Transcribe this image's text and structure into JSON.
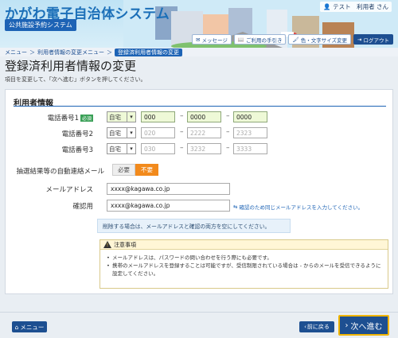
{
  "header": {
    "app_title": "かがわ電子自治体システム",
    "app_subtitle": "公共施設予約システム",
    "user_label": "テスト　利用者 さん",
    "buttons": {
      "message": "メッセージ",
      "help": "ご利用の手引き",
      "display": "色・文字サイズ変更",
      "logout": "ログアウト"
    }
  },
  "breadcrumb": {
    "items": [
      "メニュー",
      "利用者情報の変更メニュー"
    ],
    "current": "登録済利用者情報の変更"
  },
  "page": {
    "title": "登録済利用者情報の変更",
    "description": "項目を変更して、「次へ進む」ボタンを押してください。"
  },
  "section": {
    "title": "利用者情報",
    "required_badge": "必須",
    "phones": [
      {
        "label": "電話番号1",
        "type": "自宅",
        "parts": [
          "000",
          "0000",
          "0000"
        ],
        "filled": true
      },
      {
        "label": "電話番号2",
        "type": "自宅",
        "parts": [
          "020",
          "2222",
          "2323"
        ],
        "filled": false
      },
      {
        "label": "電話番号3",
        "type": "自宅",
        "parts": [
          "030",
          "3232",
          "3333"
        ],
        "filled": false
      }
    ],
    "lottery_mail": {
      "label": "抽選結果等の自動連絡メール",
      "option_need": "必要",
      "option_noneed": "不要",
      "selected": "不要"
    },
    "email": {
      "label": "メールアドレス",
      "value": "xxxx@kagawa.co.jp"
    },
    "confirm": {
      "label": "確認用",
      "value": "xxxx@kagawa.co.jp",
      "hint": "確認のため同じメールアドレスを入力してください。"
    },
    "delete_info": "削除する場合は、メールアドレスと確認の両方を空にしてください。",
    "notice": {
      "title": "注意事項",
      "items": [
        "メールアドレスは、パスワードの問い合わせを行う際にも必要です。",
        "携帯のメールアドレスを登録することは可能ですが、受信制限されている場合は - からのメールを受信できるように設定してください。"
      ]
    }
  },
  "footer": {
    "menu": "メニュー",
    "back": "前に戻る",
    "next": "次へ進む"
  },
  "colors": {
    "primary": "#1d4f91",
    "accent_orange": "#f28a1c",
    "required_green": "#3aa057",
    "filled_bg": "#eef9d7"
  }
}
